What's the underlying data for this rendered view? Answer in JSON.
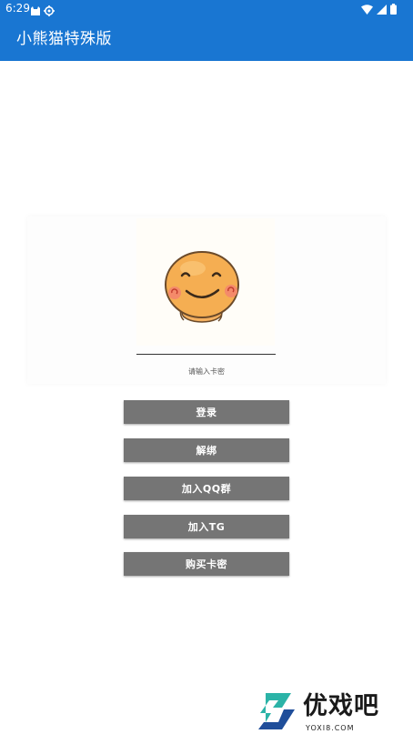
{
  "status_bar": {
    "time": "6:29",
    "icons_left": [
      "cat-icon",
      "settings-gear-icon"
    ],
    "icons_right": [
      "wifi-icon",
      "cellular-signal-icon",
      "battery-icon"
    ]
  },
  "app_bar": {
    "title": "小熊猫特殊版",
    "color": "#1976d2"
  },
  "card": {
    "avatar": "smiley-face-avatar",
    "input_value": "",
    "hint": "请输入卡密"
  },
  "buttons": {
    "login": "登录",
    "unbind": "解绑",
    "join_qq": "加入QQ群",
    "join_tg": "加入TG",
    "buy_card": "购买卡密",
    "color": "#757575"
  },
  "watermark": {
    "text": "优戏吧",
    "domain": "YOXI8.COM"
  }
}
